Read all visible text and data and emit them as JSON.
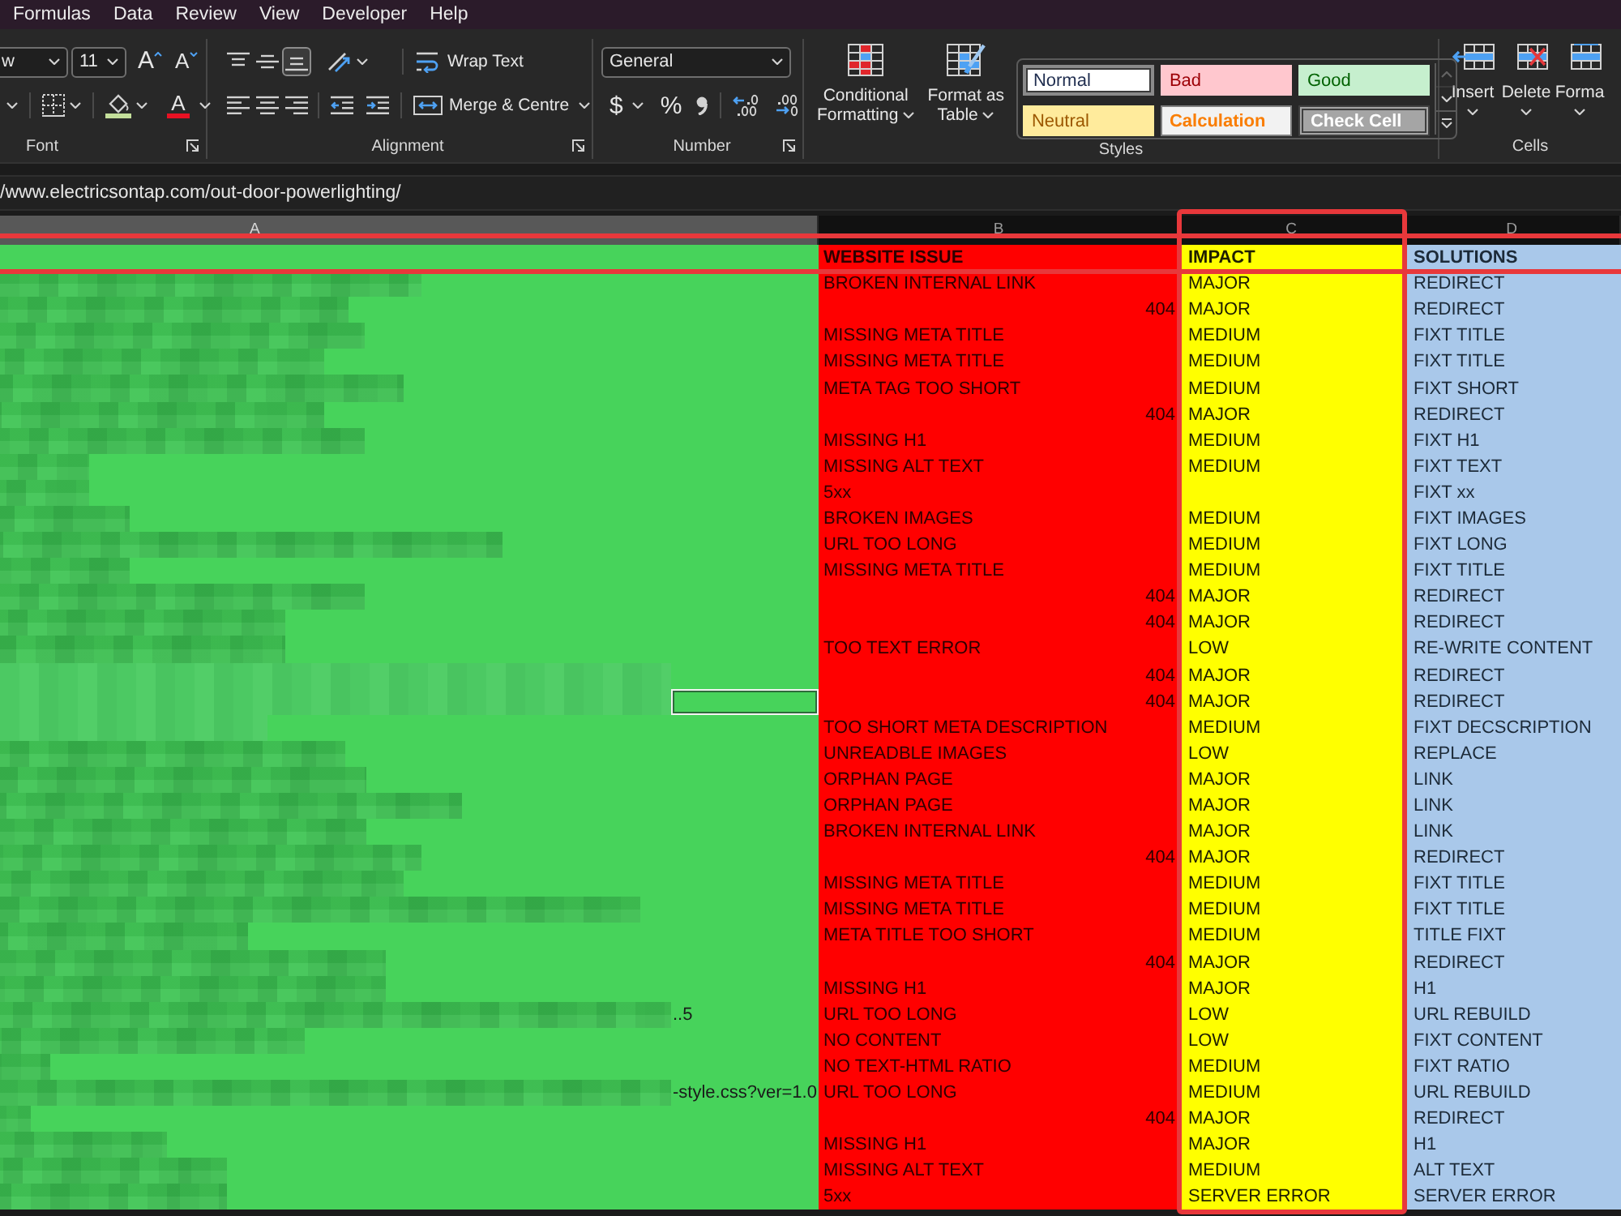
{
  "menu_tabs": [
    {
      "label": "Formulas",
      "selected": false
    },
    {
      "label": "Data",
      "selected": false
    },
    {
      "label": "Review",
      "selected": false
    },
    {
      "label": "View",
      "selected": false
    },
    {
      "label": "Developer",
      "selected": false
    },
    {
      "label": "Help",
      "selected": false
    }
  ],
  "ribbon": {
    "font": {
      "label": "Font",
      "font_name": "w",
      "font_size": "11",
      "grow_glyph": "A",
      "shrink_glyph": "A",
      "color_glyph": "A"
    },
    "alignment": {
      "label": "Alignment",
      "vertical": [
        {
          "kind": "top",
          "on": false
        },
        {
          "kind": "middle",
          "on": false
        },
        {
          "kind": "bottom",
          "on": true
        }
      ],
      "horizontal": [
        {
          "kind": "left",
          "on": false
        },
        {
          "kind": "center",
          "on": false
        },
        {
          "kind": "right",
          "on": false
        }
      ],
      "wrap_text": "Wrap Text",
      "merge": "Merge & Centre"
    },
    "number": {
      "label": "Number",
      "format": "General",
      "currency_glyph": "$",
      "percent_glyph": "%"
    },
    "styles": {
      "label": "Styles",
      "conditional_formatting": [
        "Conditional",
        "Formatting"
      ],
      "format_as_table": [
        "Format as",
        "Table"
      ],
      "cell_styles": [
        {
          "label": "Normal",
          "kind": "normal",
          "selected": true
        },
        {
          "label": "Bad",
          "kind": "bad",
          "selected": false
        },
        {
          "label": "Good",
          "kind": "good",
          "selected": false
        },
        {
          "label": "Neutral",
          "kind": "neutral",
          "selected": false
        },
        {
          "label": "Calculation",
          "kind": "calculation",
          "selected": false
        },
        {
          "label": "Check Cell",
          "kind": "check",
          "selected": false
        }
      ],
      "gallery_buttons": [
        {
          "kind": "up",
          "disabled": true
        },
        {
          "kind": "down",
          "disabled": false
        },
        {
          "kind": "more",
          "disabled": false
        }
      ]
    },
    "cells": {
      "label": "Cells",
      "buttons": [
        {
          "kind": "insert",
          "label": "Insert"
        },
        {
          "kind": "delete",
          "label": "Delete"
        },
        {
          "kind": "format",
          "label": "Forma"
        }
      ]
    }
  },
  "formula_bar": {
    "value": "/www.electricsontap.com/out-door-powerlighting/"
  },
  "sheet": {
    "columns": [
      {
        "label": "A",
        "selected": true
      },
      {
        "label": "B",
        "selected": false
      },
      {
        "label": "C",
        "selected": false
      },
      {
        "label": "D",
        "selected": false
      }
    ],
    "header": {
      "issue": "WEBSITE ISSUE",
      "impact": "IMPACT",
      "solution": "SOLUTIONS"
    },
    "rows": [
      {
        "issue": {
          "kind": "text",
          "text": "BROKEN INTERNAL LINK"
        },
        "impact": "MAJOR",
        "solution": "REDIRECT",
        "selected": false
      },
      {
        "issue": {
          "kind": "number",
          "text": "404"
        },
        "impact": "MAJOR",
        "solution": "REDIRECT",
        "selected": false
      },
      {
        "issue": {
          "kind": "text",
          "text": "MISSING META TITLE"
        },
        "impact": "MEDIUM",
        "solution": "FIXT TITLE",
        "selected": false
      },
      {
        "issue": {
          "kind": "text",
          "text": "MISSING META TITLE"
        },
        "impact": "MEDIUM",
        "solution": "FIXT TITLE",
        "selected": false
      },
      {
        "issue": {
          "kind": "text",
          "text": "META TAG TOO SHORT"
        },
        "impact": "MEDIUM",
        "solution": "FIXT SHORT",
        "selected": false
      },
      {
        "issue": {
          "kind": "number",
          "text": "404"
        },
        "impact": "MAJOR",
        "solution": "REDIRECT",
        "selected": false
      },
      {
        "issue": {
          "kind": "text",
          "text": "MISSING H1"
        },
        "impact": "MEDIUM",
        "solution": "FIXT H1",
        "selected": false
      },
      {
        "issue": {
          "kind": "text",
          "text": "MISSING ALT TEXT"
        },
        "impact": "MEDIUM",
        "solution": "FIXT TEXT",
        "selected": false
      },
      {
        "issue": {
          "kind": "text",
          "text": "5xx"
        },
        "solution": "FIXT xx",
        "selected": false
      },
      {
        "issue": {
          "kind": "text",
          "text": "BROKEN IMAGES"
        },
        "impact": "MEDIUM",
        "solution": "FIXT IMAGES",
        "selected": false
      },
      {
        "issue": {
          "kind": "text",
          "text": "URL TOO LONG"
        },
        "impact": "MEDIUM",
        "solution": "FIXT LONG",
        "selected": false
      },
      {
        "issue": {
          "kind": "text",
          "text": "MISSING META TITLE"
        },
        "impact": "MEDIUM",
        "solution": "FIXT TITLE",
        "selected": false
      },
      {
        "issue": {
          "kind": "number",
          "text": "404"
        },
        "impact": "MAJOR",
        "solution": "REDIRECT",
        "selected": false
      },
      {
        "issue": {
          "kind": "number",
          "text": "404"
        },
        "impact": "MAJOR",
        "solution": "REDIRECT",
        "selected": false
      },
      {
        "issue": {
          "kind": "text",
          "text": "TOO TEXT ERROR"
        },
        "impact": "LOW",
        "solution": "RE-WRITE CONTENT",
        "selected": false
      },
      {
        "issue": {
          "kind": "number",
          "text": "404"
        },
        "impact": "MAJOR",
        "solution": "REDIRECT",
        "selected": false
      },
      {
        "issue": {
          "kind": "number",
          "text": "404"
        },
        "impact": "MAJOR",
        "solution": "REDIRECT",
        "selected": true
      },
      {
        "issue": {
          "kind": "text",
          "text": "TOO SHORT META DESCRIPTION"
        },
        "impact": "MEDIUM",
        "solution": "FIXT DECSCRIPTION",
        "selected": false
      },
      {
        "issue": {
          "kind": "text",
          "text": "UNREADBLE IMAGES"
        },
        "impact": "LOW",
        "solution": "REPLACE",
        "selected": false
      },
      {
        "issue": {
          "kind": "text",
          "text": "ORPHAN PAGE"
        },
        "impact": "MAJOR",
        "solution": "LINK",
        "selected": false
      },
      {
        "issue": {
          "kind": "text",
          "text": "ORPHAN PAGE"
        },
        "impact": "MAJOR",
        "solution": "LINK",
        "selected": false
      },
      {
        "issue": {
          "kind": "text",
          "text": "BROKEN INTERNAL LINK"
        },
        "impact": "MAJOR",
        "solution": "LINK",
        "selected": false
      },
      {
        "issue": {
          "kind": "number",
          "text": "404"
        },
        "impact": "MAJOR",
        "solution": "REDIRECT",
        "selected": false
      },
      {
        "issue": {
          "kind": "text",
          "text": "MISSING META TITLE"
        },
        "impact": "MEDIUM",
        "solution": "FIXT TITLE",
        "selected": false
      },
      {
        "issue": {
          "kind": "text",
          "text": "MISSING META TITLE"
        },
        "impact": "MEDIUM",
        "solution": "FIXT TITLE",
        "selected": false
      },
      {
        "issue": {
          "kind": "text",
          "text": "META TITLE TOO SHORT"
        },
        "impact": "MEDIUM",
        "solution": "TITLE FIXT",
        "selected": false
      },
      {
        "issue": {
          "kind": "number",
          "text": "404"
        },
        "impact": "MAJOR",
        "solution": "REDIRECT",
        "selected": false
      },
      {
        "issue": {
          "kind": "text",
          "text": "MISSING H1"
        },
        "impact": "MAJOR",
        "solution": "H1",
        "selected": false
      },
      {
        "column_a": "..5",
        "issue": {
          "kind": "text",
          "text": "URL TOO LONG"
        },
        "impact": "LOW",
        "solution": "URL REBUILD",
        "selected": false
      },
      {
        "issue": {
          "kind": "text",
          "text": "NO CONTENT"
        },
        "impact": "LOW",
        "solution": "FIXT CONTENT",
        "selected": false
      },
      {
        "issue": {
          "kind": "text",
          "text": "NO TEXT-HTML RATIO"
        },
        "impact": "MEDIUM",
        "solution": "FIXT RATIO",
        "selected": false
      },
      {
        "column_a": "-style.css?ver=1.0",
        "issue": {
          "kind": "text",
          "text": "URL TOO LONG"
        },
        "impact": "MEDIUM",
        "solution": "URL REBUILD",
        "selected": false
      },
      {
        "issue": {
          "kind": "number",
          "text": "404"
        },
        "impact": "MAJOR",
        "solution": "REDIRECT",
        "selected": false
      },
      {
        "issue": {
          "kind": "text",
          "text": "MISSING H1"
        },
        "impact": "MAJOR",
        "solution": "H1",
        "selected": false
      },
      {
        "issue": {
          "kind": "text",
          "text": "MISSING ALT TEXT"
        },
        "impact": "MEDIUM",
        "solution": "ALT TEXT",
        "selected": false
      },
      {
        "issue": {
          "kind": "text",
          "text": "5xx"
        },
        "impact": "SERVER ERROR",
        "solution": "SERVER ERROR",
        "selected": false
      }
    ]
  }
}
